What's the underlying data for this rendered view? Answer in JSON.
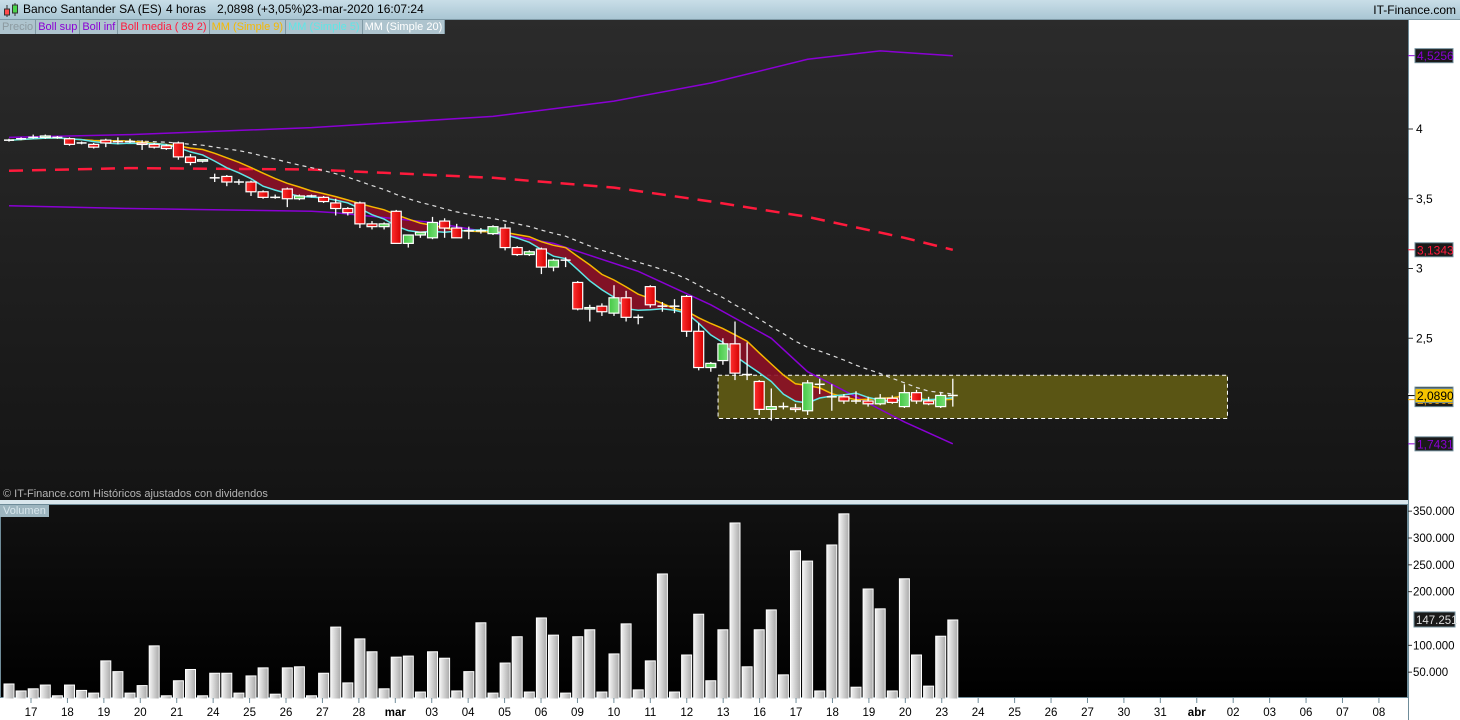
{
  "header": {
    "title": "Banco Santander SA (ES)",
    "timeframe": "4 horas",
    "price_change": "2,0898 (+3,05%)",
    "datetime": "23-mar-2020 16:07:24",
    "brand": "IT-Finance.com"
  },
  "legend": [
    {
      "label": "Precio",
      "color": "#8c9aa0"
    },
    {
      "label": "Boll sup",
      "color": "#8a00d4"
    },
    {
      "label": "Boll inf",
      "color": "#8a00d4"
    },
    {
      "label": "Boll media ( 89 2)",
      "color": "#ff1a3c"
    },
    {
      "label": "MM (Simple 9)",
      "color": "#f5b800"
    },
    {
      "label": "MM (Simple 5)",
      "color": "#5fe6e6"
    },
    {
      "label": "MM (Simple 20)",
      "color": "#ffffff"
    }
  ],
  "copyright": "© IT-Finance.com  Históricos ajustados con dividendos",
  "volume_label": "Volumen",
  "colors": {
    "up": "#5cd35c",
    "down": "#ff1f1f",
    "shade": "#8c0f26",
    "highlight": "#5a5514"
  },
  "chart_data": [
    {
      "type": "candlestick",
      "title": "Banco Santander SA (ES) 4 horas",
      "ylim": [
        1.45,
        4.9
      ],
      "yticks": [
        {
          "v": 4,
          "label": "4"
        },
        {
          "v": 3.5,
          "label": "3,5"
        },
        {
          "v": 3,
          "label": "3"
        },
        {
          "v": 2.5,
          "label": "2,5"
        }
      ],
      "markers": [
        {
          "v": 4.5256,
          "label": "4,5256",
          "color": "#8a00d4",
          "bg": "#1a1a1a"
        },
        {
          "v": 3.1343,
          "label": "3,1343",
          "color": "#ff1a3c",
          "bg": "#1a1a1a"
        },
        {
          "v": 2.0996,
          "label": "2,0996",
          "color": "#ffffff",
          "bg": "#1a1a1a"
        },
        {
          "v": 2.0601,
          "label": "2,0601",
          "color": "#f5a500",
          "bg": "#1a1a1a"
        },
        {
          "v": 2.089,
          "label": "2,0890",
          "color": "#000000",
          "bg": "#f5c400"
        },
        {
          "v": 1.7431,
          "label": "1,7431",
          "color": "#8a00d4",
          "bg": "#1a1a1a"
        }
      ],
      "ohlc": [
        [
          3.92,
          3.93,
          3.91,
          3.92
        ],
        [
          3.93,
          3.94,
          3.92,
          3.93
        ],
        [
          3.94,
          3.96,
          3.93,
          3.94
        ],
        [
          3.94,
          3.96,
          3.93,
          3.95
        ],
        [
          3.94,
          3.95,
          3.93,
          3.94
        ],
        [
          3.93,
          3.94,
          3.88,
          3.89
        ],
        [
          3.9,
          3.91,
          3.89,
          3.9
        ],
        [
          3.89,
          3.9,
          3.86,
          3.87
        ],
        [
          3.92,
          3.93,
          3.87,
          3.9
        ],
        [
          3.91,
          3.94,
          3.89,
          3.91
        ],
        [
          3.91,
          3.93,
          3.9,
          3.91
        ],
        [
          3.9,
          3.92,
          3.85,
          3.89
        ],
        [
          3.89,
          3.9,
          3.86,
          3.87
        ],
        [
          3.88,
          3.89,
          3.85,
          3.86
        ],
        [
          3.9,
          3.91,
          3.78,
          3.8
        ],
        [
          3.8,
          3.82,
          3.74,
          3.76
        ],
        [
          3.77,
          3.78,
          3.76,
          3.78
        ],
        [
          3.65,
          3.68,
          3.62,
          3.65
        ],
        [
          3.66,
          3.67,
          3.59,
          3.62
        ],
        [
          3.62,
          3.64,
          3.6,
          3.62
        ],
        [
          3.62,
          3.63,
          3.52,
          3.55
        ],
        [
          3.55,
          3.56,
          3.5,
          3.51
        ],
        [
          3.51,
          3.53,
          3.5,
          3.51
        ],
        [
          3.57,
          3.58,
          3.44,
          3.5
        ],
        [
          3.5,
          3.53,
          3.49,
          3.52
        ],
        [
          3.52,
          3.53,
          3.51,
          3.52
        ],
        [
          3.51,
          3.52,
          3.47,
          3.48
        ],
        [
          3.47,
          3.5,
          3.38,
          3.43
        ],
        [
          3.43,
          3.44,
          3.38,
          3.4
        ],
        [
          3.47,
          3.48,
          3.29,
          3.32
        ],
        [
          3.32,
          3.34,
          3.28,
          3.3
        ],
        [
          3.3,
          3.33,
          3.28,
          3.32
        ],
        [
          3.41,
          3.42,
          3.18,
          3.18
        ],
        [
          3.18,
          3.24,
          3.15,
          3.24
        ],
        [
          3.24,
          3.26,
          3.22,
          3.26
        ],
        [
          3.22,
          3.37,
          3.21,
          3.33
        ],
        [
          3.34,
          3.36,
          3.22,
          3.29
        ],
        [
          3.29,
          3.32,
          3.22,
          3.22
        ],
        [
          3.27,
          3.3,
          3.21,
          3.27
        ],
        [
          3.27,
          3.29,
          3.25,
          3.27
        ],
        [
          3.25,
          3.31,
          3.24,
          3.3
        ],
        [
          3.29,
          3.32,
          3.13,
          3.15
        ],
        [
          3.15,
          3.16,
          3.09,
          3.1
        ],
        [
          3.1,
          3.13,
          3.09,
          3.12
        ],
        [
          3.14,
          3.15,
          2.96,
          3.01
        ],
        [
          3.01,
          3.07,
          2.98,
          3.06
        ],
        [
          3.06,
          3.08,
          3.01,
          3.06
        ],
        [
          2.9,
          2.91,
          2.7,
          2.71
        ],
        [
          2.71,
          2.74,
          2.62,
          2.72
        ],
        [
          2.73,
          2.75,
          2.66,
          2.69
        ],
        [
          2.68,
          2.88,
          2.66,
          2.79
        ],
        [
          2.79,
          2.84,
          2.62,
          2.65
        ],
        [
          2.65,
          2.67,
          2.6,
          2.65
        ],
        [
          2.87,
          2.88,
          2.72,
          2.74
        ],
        [
          2.73,
          2.76,
          2.69,
          2.73
        ],
        [
          2.73,
          2.78,
          2.68,
          2.73
        ],
        [
          2.8,
          2.81,
          2.51,
          2.55
        ],
        [
          2.55,
          2.61,
          2.27,
          2.29
        ],
        [
          2.29,
          2.33,
          2.26,
          2.32
        ],
        [
          2.34,
          2.5,
          2.31,
          2.46
        ],
        [
          2.46,
          2.62,
          2.2,
          2.25
        ],
        [
          2.24,
          2.47,
          2.2,
          2.24
        ],
        [
          2.19,
          2.2,
          1.95,
          1.99
        ],
        [
          1.99,
          2.14,
          1.91,
          2.01
        ],
        [
          2.01,
          2.04,
          1.99,
          2.01
        ],
        [
          2.0,
          2.03,
          1.97,
          1.99
        ],
        [
          1.98,
          2.2,
          1.95,
          2.18
        ],
        [
          2.17,
          2.21,
          2.1,
          2.17
        ],
        [
          2.08,
          2.17,
          1.98,
          2.08
        ],
        [
          2.08,
          2.1,
          2.03,
          2.05
        ],
        [
          2.05,
          2.12,
          2.03,
          2.05
        ],
        [
          2.05,
          2.08,
          2.01,
          2.03
        ],
        [
          2.03,
          2.1,
          2.02,
          2.07
        ],
        [
          2.07,
          2.09,
          2.03,
          2.04
        ],
        [
          2.01,
          2.17,
          2.0,
          2.11
        ],
        [
          2.11,
          2.13,
          2.03,
          2.05
        ],
        [
          2.05,
          2.08,
          2.02,
          2.03
        ],
        [
          2.01,
          2.11,
          2.0,
          2.09
        ],
        [
          2.09,
          2.21,
          2.01,
          2.0898
        ]
      ],
      "bollinger": {
        "sup": [
          [
            0,
            3.94
          ],
          [
            10,
            3.96
          ],
          [
            25,
            4.01
          ],
          [
            40,
            4.09
          ],
          [
            50,
            4.2
          ],
          [
            58,
            4.33
          ],
          [
            66,
            4.5
          ],
          [
            72,
            4.56
          ],
          [
            78,
            4.5256
          ]
        ],
        "media": [
          [
            0,
            3.7
          ],
          [
            10,
            3.72
          ],
          [
            25,
            3.71
          ],
          [
            40,
            3.65
          ],
          [
            50,
            3.58
          ],
          [
            58,
            3.48
          ],
          [
            66,
            3.37
          ],
          [
            74,
            3.22
          ],
          [
            78,
            3.1343
          ]
        ],
        "inf": [
          [
            0,
            3.45
          ],
          [
            10,
            3.43
          ],
          [
            25,
            3.41
          ],
          [
            27,
            3.4
          ],
          [
            35,
            3.33
          ],
          [
            45,
            3.18
          ],
          [
            52,
            2.98
          ],
          [
            58,
            2.74
          ],
          [
            63,
            2.5
          ],
          [
            66,
            2.26
          ],
          [
            70,
            2.08
          ],
          [
            74,
            1.9
          ],
          [
            78,
            1.7431
          ]
        ]
      },
      "highlight_zone": {
        "from_bar": 58.6,
        "to_bar": 100.7,
        "low": 1.925,
        "high": 2.235
      }
    },
    {
      "type": "bar",
      "title": "Volumen",
      "ylim": [
        0,
        360000
      ],
      "yticks": [
        {
          "v": 350000,
          "label": "350.000"
        },
        {
          "v": 300000,
          "label": "300.000"
        },
        {
          "v": 250000,
          "label": "250.000"
        },
        {
          "v": 200000,
          "label": "200.000"
        },
        {
          "v": 100000,
          "label": "100.000"
        },
        {
          "v": 50000,
          "label": "50.000"
        }
      ],
      "last_label": {
        "v": 147251,
        "label": "147.251"
      },
      "values": [
        28000,
        15000,
        19000,
        26000,
        6000,
        26000,
        16000,
        11000,
        71000,
        51000,
        11000,
        25000,
        99000,
        6000,
        34000,
        55000,
        6000,
        48000,
        48000,
        11000,
        43000,
        58000,
        9000,
        58000,
        60000,
        6000,
        48000,
        134000,
        30000,
        112000,
        88000,
        19000,
        78000,
        80000,
        13000,
        88000,
        76000,
        15000,
        51000,
        142000,
        11000,
        67000,
        116000,
        13000,
        151000,
        119000,
        11000,
        116000,
        129000,
        13000,
        84000,
        140000,
        17000,
        71000,
        233000,
        13000,
        82000,
        158000,
        34000,
        129000,
        328000,
        60000,
        129000,
        166000,
        45000,
        276000,
        257000,
        15000,
        287000,
        345000,
        22000,
        205000,
        168000,
        15000,
        224000,
        82000,
        24000,
        117000,
        147251
      ]
    }
  ],
  "x_axis": {
    "labels": [
      "17",
      "18",
      "19",
      "20",
      "21",
      "24",
      "25",
      "26",
      "27",
      "28",
      "mar",
      "03",
      "04",
      "05",
      "06",
      "09",
      "10",
      "11",
      "12",
      "13",
      "16",
      "17",
      "18",
      "19",
      "20",
      "23",
      "24",
      "25",
      "26",
      "27",
      "30",
      "31",
      "abr",
      "02",
      "03",
      "06",
      "07",
      "08"
    ],
    "bold": [
      "mar",
      "abr"
    ]
  }
}
